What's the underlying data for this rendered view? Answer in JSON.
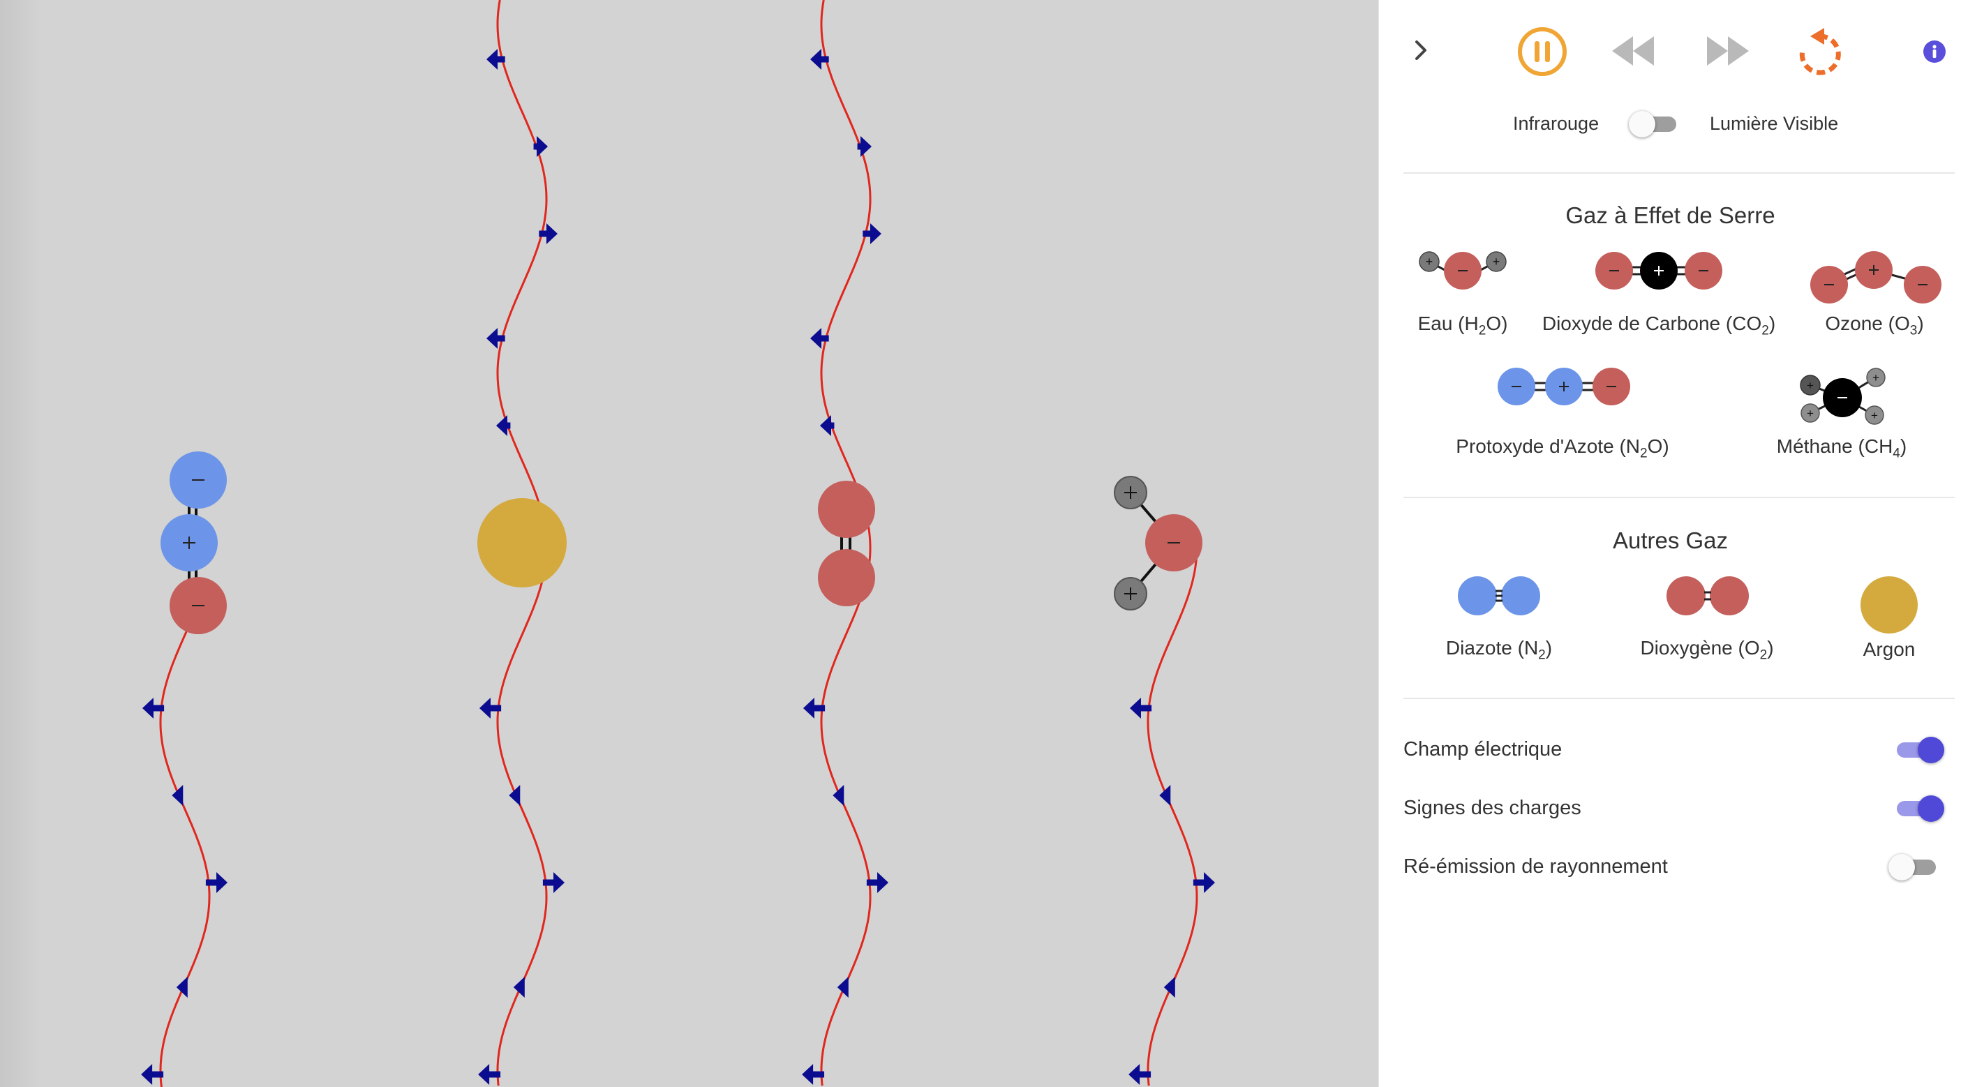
{
  "controls": {
    "collapse_icon": "chevron-right-icon",
    "pause_icon": "pause-icon",
    "rewind_icon": "rewind-icon",
    "fast_forward_icon": "fast-forward-icon",
    "reset_icon": "reset-icon",
    "info_icon": "info-icon",
    "light_left_label": "Infrarouge",
    "light_right_label": "Lumière Visible"
  },
  "greenhouse": {
    "title": "Gaz à Effet de Serre",
    "water": {
      "name": "Eau (H",
      "sub": "2",
      "tail": "O)"
    },
    "co2": {
      "name": "Dioxyde de Carbone (CO",
      "sub": "2",
      "tail": ")"
    },
    "ozone": {
      "name": "Ozone (O",
      "sub": "3",
      "tail": ")"
    },
    "n2o": {
      "name": "Protoxyde d'Azote (N",
      "sub": "2",
      "tail": "O)"
    },
    "methane": {
      "name": "Méthane (CH",
      "sub": "4",
      "tail": ")"
    }
  },
  "other": {
    "title": "Autres Gaz",
    "n2": {
      "name": "Diazote (N",
      "sub": "2",
      "tail": ")"
    },
    "o2": {
      "name": "Dioxygène (O",
      "sub": "2",
      "tail": ")"
    },
    "argon": {
      "name": "Argon"
    }
  },
  "options": {
    "electric_field": {
      "label": "Champ électrique",
      "on": true
    },
    "charge_signs": {
      "label": "Signes des charges",
      "on": true
    },
    "reemission": {
      "label": "Ré-émission de rayonnement",
      "on": false
    }
  },
  "light_toggle_on": false,
  "colors": {
    "oxygen": "#c45f5c",
    "nitrogen": "#6c94e8",
    "argon": "#d4aa3f",
    "hydrogen": "#7a7a7a",
    "carbon": "#000000",
    "wave": "#e0271d",
    "arrow": "#0b0c8f",
    "play_accent": "#f0a534",
    "reset_accent": "#ed6d2a",
    "switch_on": "#5048d6"
  }
}
